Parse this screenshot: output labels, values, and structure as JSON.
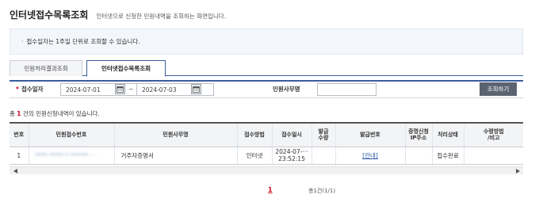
{
  "header": {
    "title": "인터넷접수목록조회",
    "description": "인터넷으로 신청한 민원내역을 조회하는 화면입니다."
  },
  "notice": {
    "bullet": "·",
    "text": "접수일자는 1주일 단위로 조회할 수 있습니다."
  },
  "tabs": [
    {
      "label": "민원처리결과조회",
      "active": false
    },
    {
      "label": "인터넷접수목록조회",
      "active": true
    }
  ],
  "search": {
    "required_mark": "*",
    "date_label": "접수일자",
    "date_from": "2024-07-01",
    "date_to": "2024-07-03",
    "separator": "~",
    "office_label": "민원사무명",
    "office_value": "",
    "button_label": "조회하기"
  },
  "result": {
    "prefix": "총",
    "count": "1",
    "suffix": "건의 민원신청내역이 있습니다."
  },
  "table": {
    "headers": {
      "no": "번호",
      "app_no": "민원접수번호",
      "office": "민원사무명",
      "method": "접수방법",
      "datetime": "접수일시",
      "issue_qty_1": "발급",
      "issue_qty_2": "수량",
      "issue_no": "발급번호",
      "ip_1": "증명신청",
      "ip_2": "IP주소",
      "status": "처리상태",
      "receive_1": "수령방법",
      "receive_2": "/비고"
    },
    "rows": [
      {
        "no": "1",
        "app_no": "**** ***** * ****** ···",
        "office": "거주자증명서",
        "method": "인터넷",
        "date": "2024-07-···",
        "time": "23:52:15",
        "issue_qty": "",
        "issue_no": "[안내]",
        "ip": "",
        "status": "접수완료",
        "receive": ""
      }
    ]
  },
  "pager": {
    "current": "1",
    "total": "총1건(1/1)"
  },
  "colors": {
    "accent": "#3a5d9c",
    "highlight": "#d0021b",
    "button": "#5b6270",
    "link": "#2a57a8"
  }
}
